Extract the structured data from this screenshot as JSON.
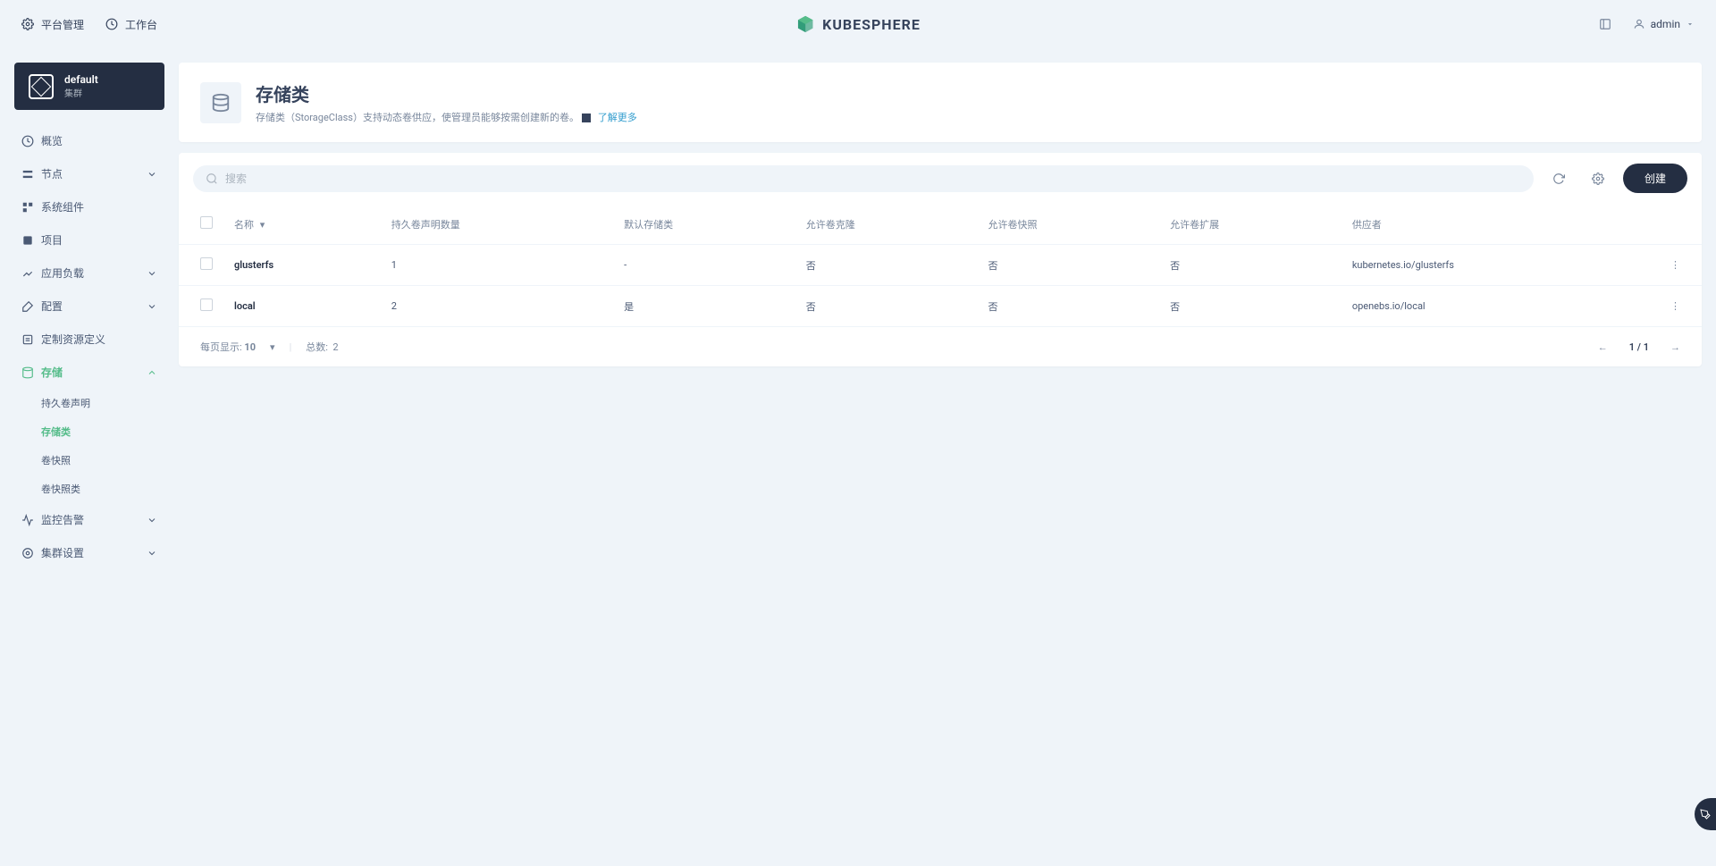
{
  "header": {
    "platform_mgmt": "平台管理",
    "workbench": "工作台",
    "logo_text": "KUBESPHERE",
    "username": "admin"
  },
  "cluster": {
    "name": "default",
    "type": "集群"
  },
  "nav": {
    "overview": "概览",
    "nodes": "节点",
    "system_components": "系统组件",
    "projects": "项目",
    "app_workloads": "应用负载",
    "config": "配置",
    "crd": "定制资源定义",
    "storage": "存储",
    "storage_sub": {
      "pvc": "持久卷声明",
      "storage_class": "存储类",
      "volume_snapshot": "卷快照",
      "volume_snapshot_class": "卷快照类"
    },
    "monitoring": "监控告警",
    "cluster_settings": "集群设置"
  },
  "page": {
    "title": "存储类",
    "description": "存储类（StorageClass）支持动态卷供应，使管理员能够按需创建新的卷。",
    "learn_more": "了解更多"
  },
  "toolbar": {
    "search_placeholder": "搜索",
    "create_button": "创建"
  },
  "table": {
    "columns": {
      "name": "名称",
      "pvc_count": "持久卷声明数量",
      "default_sc": "默认存储类",
      "allow_clone": "允许卷克隆",
      "allow_snapshot": "允许卷快照",
      "allow_expand": "允许卷扩展",
      "provisioner": "供应者"
    },
    "rows": [
      {
        "name": "glusterfs",
        "pvc_count": "1",
        "default_sc": "-",
        "allow_clone": "否",
        "allow_snapshot": "否",
        "allow_expand": "否",
        "provisioner": "kubernetes.io/glusterfs"
      },
      {
        "name": "local",
        "pvc_count": "2",
        "default_sc": "是",
        "allow_clone": "否",
        "allow_snapshot": "否",
        "allow_expand": "否",
        "provisioner": "openebs.io/local"
      }
    ]
  },
  "pagination": {
    "per_page_label": "每页显示:",
    "per_page_value": "10",
    "total_label": "总数:",
    "total_value": "2",
    "page_info": "1 / 1"
  }
}
